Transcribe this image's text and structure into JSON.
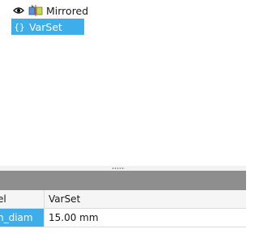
{
  "tree": {
    "items": [
      {
        "label": "Mirrored",
        "icon": "eye-icon",
        "type_icon": "mirrored-feature-icon",
        "selected": false
      },
      {
        "label": "VarSet",
        "icon": "varset-icon",
        "selected": true
      }
    ]
  },
  "properties": {
    "rows": [
      {
        "name": "el",
        "value": "VarSet"
      },
      {
        "name": "n_diam",
        "value": "15.00 mm"
      }
    ]
  },
  "colors": {
    "selection": "#3daee9",
    "header": "#8e8e8e"
  }
}
